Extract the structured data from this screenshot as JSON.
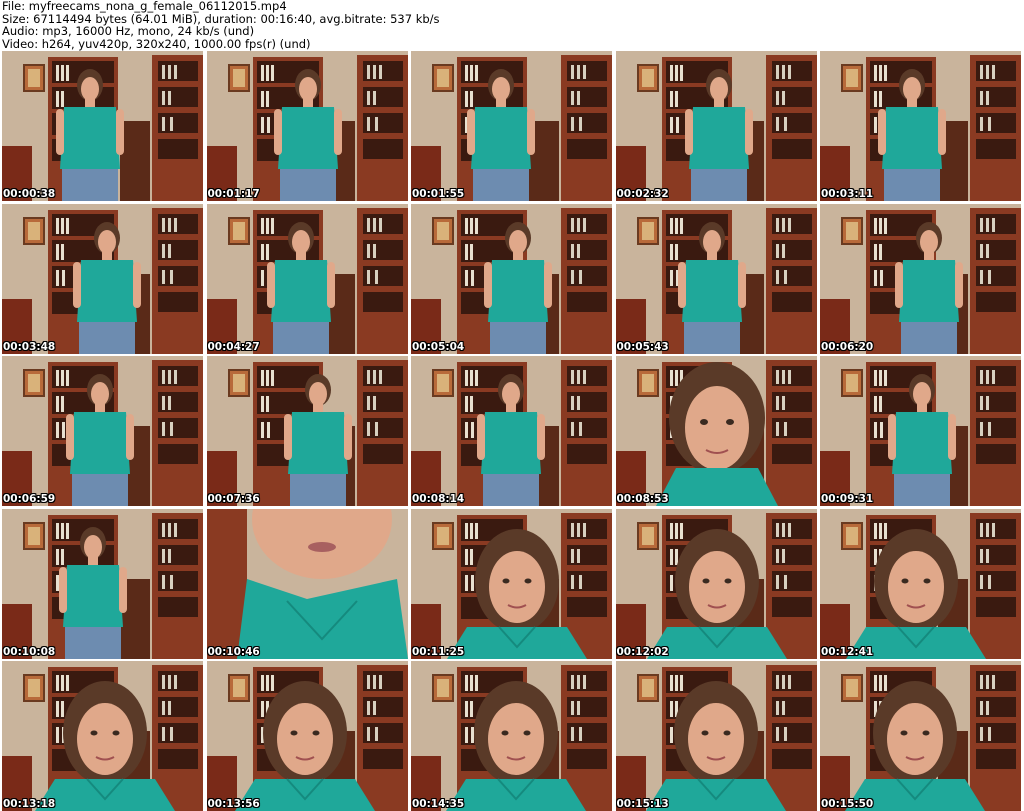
{
  "info": {
    "file": "File: myfreecams_nona_g_female_06112015.mp4",
    "size": "Size: 67114494 bytes (64.01 MiB), duration: 00:16:40, avg.bitrate: 537 kb/s",
    "audio": "Audio: mp3, 16000 Hz, mono, 24 kb/s (und)",
    "video": "Video: h264, yuv420p, 320x240, 1000.00 fps(r) (und)"
  },
  "thumbnails": [
    {
      "time": "00:00:38",
      "shot": "body"
    },
    {
      "time": "00:01:17",
      "shot": "body"
    },
    {
      "time": "00:01:55",
      "shot": "body"
    },
    {
      "time": "00:02:32",
      "shot": "body"
    },
    {
      "time": "00:03:11",
      "shot": "body"
    },
    {
      "time": "00:03:48",
      "shot": "body"
    },
    {
      "time": "00:04:27",
      "shot": "body"
    },
    {
      "time": "00:05:04",
      "shot": "body"
    },
    {
      "time": "00:05:43",
      "shot": "body"
    },
    {
      "time": "00:06:20",
      "shot": "body"
    },
    {
      "time": "00:06:59",
      "shot": "body"
    },
    {
      "time": "00:07:36",
      "shot": "body"
    },
    {
      "time": "00:08:14",
      "shot": "body"
    },
    {
      "time": "00:08:53",
      "shot": "face"
    },
    {
      "time": "00:09:31",
      "shot": "body"
    },
    {
      "time": "00:10:08",
      "shot": "body"
    },
    {
      "time": "00:10:46",
      "shot": "extreme-closeup"
    },
    {
      "time": "00:11:25",
      "shot": "closeup"
    },
    {
      "time": "00:12:02",
      "shot": "closeup"
    },
    {
      "time": "00:12:41",
      "shot": "closeup"
    },
    {
      "time": "00:13:18",
      "shot": "closeup"
    },
    {
      "time": "00:13:56",
      "shot": "closeup"
    },
    {
      "time": "00:14:35",
      "shot": "closeup"
    },
    {
      "time": "00:15:13",
      "shot": "closeup"
    },
    {
      "time": "00:15:50",
      "shot": "closeup"
    }
  ],
  "colors": {
    "wall": "#c9b49c",
    "shelf": "#8a3a22",
    "shirt": "#1fa89a",
    "jeans": "#6d8cb0",
    "skin": "#e0a88a",
    "hair": "#5a3a28"
  }
}
